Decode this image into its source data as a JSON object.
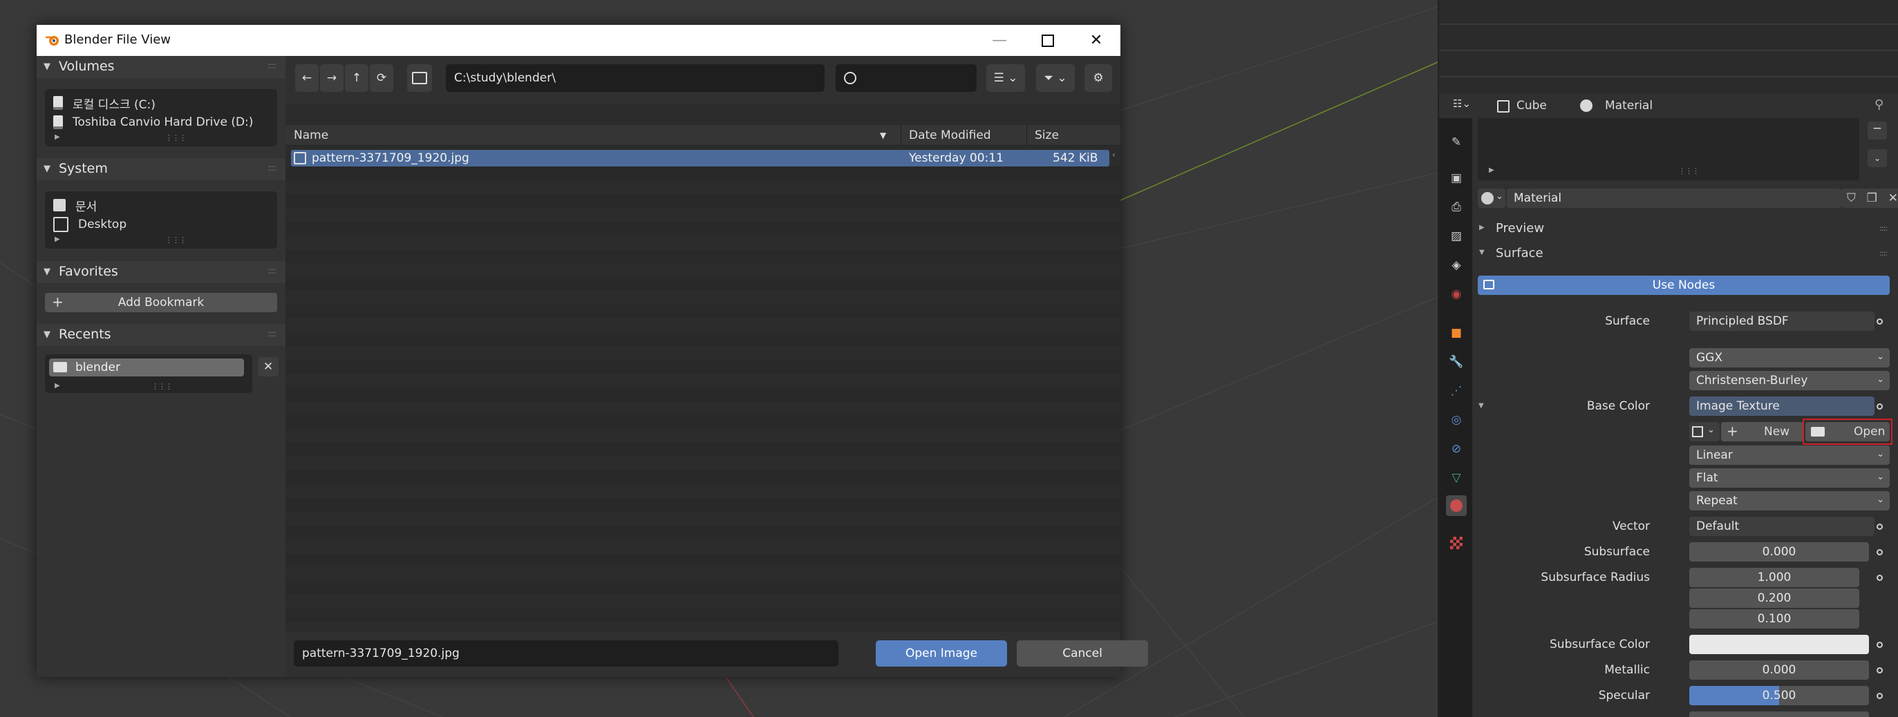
{
  "dialog": {
    "title": "Blender File View",
    "path": "C:\\study\\blender\\",
    "filename": "pattern-3371709_1920.jpg",
    "open_label": "Open Image",
    "cancel_label": "Cancel"
  },
  "sidebar": {
    "volumes": {
      "title": "Volumes",
      "items": [
        "로컬 디스크 (C:)",
        "Toshiba Canvio Hard Drive (D:)"
      ]
    },
    "system": {
      "title": "System",
      "items": [
        "문서",
        "Desktop"
      ]
    },
    "favorites": {
      "title": "Favorites",
      "add_label": "Add Bookmark"
    },
    "recents": {
      "title": "Recents",
      "items": [
        "blender"
      ]
    }
  },
  "file_list": {
    "columns": {
      "name": "Name",
      "date": "Date Modified",
      "size": "Size"
    },
    "files": [
      {
        "name": "pattern-3371709_1920.jpg",
        "date": "Yesterday 00:11",
        "size": "542 KiB"
      }
    ]
  },
  "properties": {
    "breadcrumb": {
      "object": "Cube",
      "material": "Material"
    },
    "material_name": "Material",
    "panels": {
      "preview": "Preview",
      "surface": "Surface"
    },
    "use_nodes": "Use Nodes",
    "rows": {
      "surface": {
        "label": "Surface",
        "value": "Principled BSDF"
      },
      "distribution": "GGX",
      "subsurface_method": "Christensen-Burley",
      "base_color": {
        "label": "Base Color",
        "value": "Image Texture"
      },
      "new_label": "New",
      "open_label": "Open",
      "interpolation": "Linear",
      "projection": "Flat",
      "extension": "Repeat",
      "vector": {
        "label": "Vector",
        "value": "Default"
      },
      "subsurface": {
        "label": "Subsurface",
        "value": "0.000"
      },
      "subsurface_radius": {
        "label": "Subsurface Radius",
        "values": [
          "1.000",
          "0.200",
          "0.100"
        ]
      },
      "subsurface_color": {
        "label": "Subsurface Color"
      },
      "metallic": {
        "label": "Metallic",
        "value": "0.000"
      },
      "specular": {
        "label": "Specular",
        "value": "0.500",
        "fraction": 0.5
      }
    }
  },
  "colors": {
    "accent": "#5680c2",
    "selection": "#4b6a99",
    "highlight_box": "#d11f2a"
  }
}
